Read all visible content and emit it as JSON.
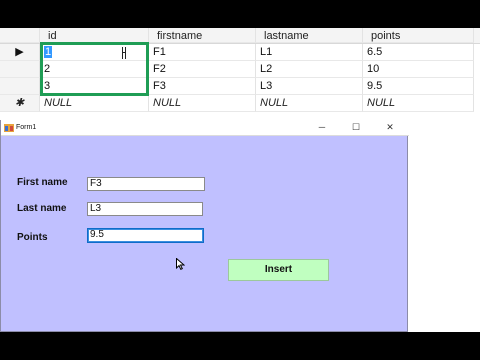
{
  "grid": {
    "columns": [
      "id",
      "firstname",
      "lastname",
      "points"
    ],
    "rows": [
      {
        "selector": "▶",
        "id": "1",
        "firstname": "F1",
        "lastname": "L1",
        "points": "6.5"
      },
      {
        "selector": "",
        "id": "2",
        "firstname": "F2",
        "lastname": "L2",
        "points": "10"
      },
      {
        "selector": "",
        "id": "3",
        "firstname": "F3",
        "lastname": "L3",
        "points": "9.5"
      }
    ],
    "new_row": {
      "selector": "✱",
      "id": "NULL",
      "firstname": "NULL",
      "lastname": "NULL",
      "points": "NULL"
    }
  },
  "form": {
    "title": "Form1",
    "window_buttons": {
      "minimize": "─",
      "maximize": "☐",
      "close": "✕"
    },
    "labels": {
      "first_name": "First name",
      "last_name": "Last name",
      "points": "Points"
    },
    "values": {
      "first_name": "F3",
      "last_name": "L3",
      "points": "9.5"
    },
    "insert_label": "Insert"
  },
  "colors": {
    "form_bg": "#c0c0ff",
    "insert_bg": "#c0ffc0",
    "highlight_box": "#1f9d55"
  },
  "icons": [
    "row-pointer-icon",
    "new-row-icon",
    "text-cursor-icon",
    "app-icon",
    "mouse-pointer-icon"
  ]
}
